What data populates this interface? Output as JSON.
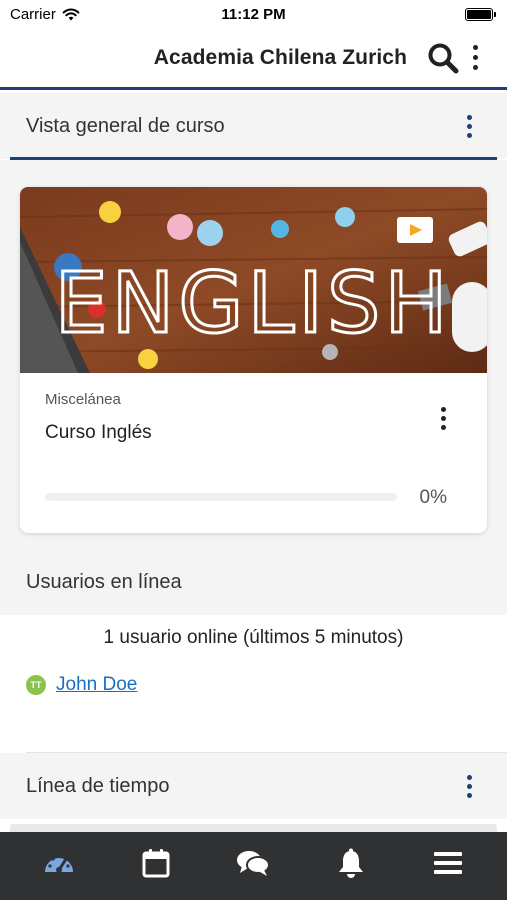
{
  "status_bar": {
    "carrier": "Carrier",
    "time": "11:12 PM"
  },
  "header": {
    "title": "Academia Chilena Zurich",
    "icons": [
      "search-icon",
      "more-vertical-icon"
    ]
  },
  "course_overview": {
    "title": "Vista general de curso",
    "course": {
      "image_text": "ENGLISH",
      "category": "Miscelánea",
      "name": "Curso Inglés",
      "progress": 0,
      "progress_label": "0%"
    }
  },
  "users_online": {
    "title": "Usuarios en línea",
    "summary": "1 usuario online (últimos 5 minutos)",
    "users": [
      {
        "initials": "TT",
        "name": "John Doe"
      }
    ]
  },
  "timeline": {
    "title": "Línea de tiempo"
  },
  "tab_bar": {
    "items": [
      "dashboard-icon",
      "calendar-icon",
      "messages-icon",
      "notifications-icon",
      "menu-icon"
    ],
    "active": "dashboard-icon"
  },
  "colors": {
    "accent": "#1d3f7a",
    "link": "#1a6fc4",
    "tab_bar_bg": "#303133",
    "active_tab": "#7aa7e0",
    "avatar_bg": "#8bc34a"
  }
}
